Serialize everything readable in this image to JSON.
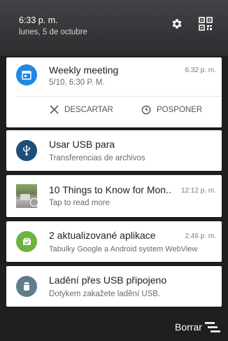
{
  "header": {
    "time": "6:33 p. m.",
    "date": "lunes, 5 de octubre"
  },
  "notifications": [
    {
      "title": "Weekly meeting",
      "subtitle": "5/10, 6:30 P. M.",
      "time": "6:32 p. m.",
      "icon": "calendar-icon",
      "color": "#1e88e5",
      "actions": [
        {
          "label": "DESCARTAR",
          "icon": "close-icon"
        },
        {
          "label": "POSPONER",
          "icon": "clock-icon"
        }
      ]
    },
    {
      "title": "Usar USB para",
      "subtitle": "Transferencias de archivos",
      "icon": "usb-icon",
      "color": "#1f4e79"
    },
    {
      "title": "10 Things to Know for Mon..",
      "subtitle": "Tap to read more",
      "time": "12:12 p. m.",
      "icon": "news-thumbnail"
    },
    {
      "title": "2 aktualizované aplikace",
      "subtitle": "Tabulky Google a Android system WebView",
      "time": "2:46 p. m.",
      "icon": "update-check-icon",
      "color": "#6db33f"
    },
    {
      "title": "Ladění přes USB připojeno",
      "subtitle": "Dotykem zakažete ladění USB.",
      "icon": "android-debug-icon",
      "color": "#607d8b"
    }
  ],
  "footer": {
    "clear_label": "Borrar"
  }
}
